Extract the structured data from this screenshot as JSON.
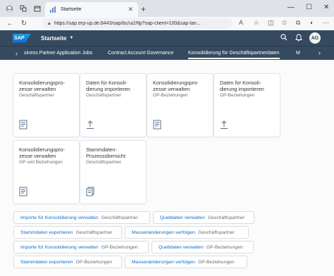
{
  "browser": {
    "tab_title": "Startseite",
    "url": "https://sap.erp-up.de:8443/sap/bc/ui2/flp?sap-client=100&sap-lan..."
  },
  "shell": {
    "logo": "SAP",
    "title": "Startseite",
    "avatar_initials": "AG"
  },
  "nav": {
    "items": [
      {
        "label": "siness Partner Application Jobs"
      },
      {
        "label": "Contract Account Governance"
      },
      {
        "label": "Konsolidierung für Geschäftspartnerdaten"
      },
      {
        "label": "M"
      }
    ],
    "active_index": 2
  },
  "tiles": [
    {
      "title": "Konsolidierungspro-zesse verwalten",
      "title_l1": "Konsolidierungspro-",
      "title_l2": "zesse verwalten",
      "subtitle": "Geschäftspartner",
      "icon": "document-list-icon"
    },
    {
      "title": "Daten für Konsolidierung importieren",
      "title_l1": "Daten für Konsoli-",
      "title_l2": "dierung importieren",
      "subtitle": "Geschäftspartner",
      "icon": "upload-icon"
    },
    {
      "title": "Konsolidierungspro-zesse verwalten",
      "title_l1": "Konsolidierungspro-",
      "title_l2": "zesse verwalten",
      "subtitle": "GP-Beziehungen",
      "icon": "document-list-icon"
    },
    {
      "title": "Daten für Konsolidierung importieren",
      "title_l1": "Daten für Konsoli-",
      "title_l2": "dierung importieren",
      "subtitle": "GP-Beziehungen",
      "icon": "upload-icon"
    },
    {
      "title": "Konsolidierungspro-zesse verwalten",
      "title_l1": "Konsolidierungspro-",
      "title_l2": "zesse verwalten",
      "subtitle": "GP und Beziehungen",
      "icon": "document-list-icon"
    },
    {
      "title": "Stammdaten-Prozessübersicht",
      "title_l1": "Stammdaten-",
      "title_l2": "Prozessübersicht",
      "subtitle": "Geschäftspartner",
      "icon": "documents-icon"
    }
  ],
  "links": [
    {
      "title": "Importe für Konsolidierung verwalten",
      "subtitle": "Geschäftspartner"
    },
    {
      "title": "Quelldaten verwalten",
      "subtitle": "Geschäftspartner"
    },
    {
      "title": "Stammdaten exportieren",
      "subtitle": "Geschäftspartner"
    },
    {
      "title": "Massenänderungen verfolgen",
      "subtitle": "Geschäftspartner"
    },
    {
      "title": "Importe für Konsolidierung verwalten",
      "subtitle": "GP-Beziehungen"
    },
    {
      "title": "Quelldaten verwalten",
      "subtitle": "GP-Beziehungen"
    },
    {
      "title": "Stammdaten exportieren",
      "subtitle": "GP-Beziehungen"
    },
    {
      "title": "Massenänderungen verfolgen",
      "subtitle": "GP-Beziehungen"
    }
  ],
  "colors": {
    "shell": "#354a5f",
    "link": "#0a6ed1",
    "accent": "#0a6ed1"
  }
}
